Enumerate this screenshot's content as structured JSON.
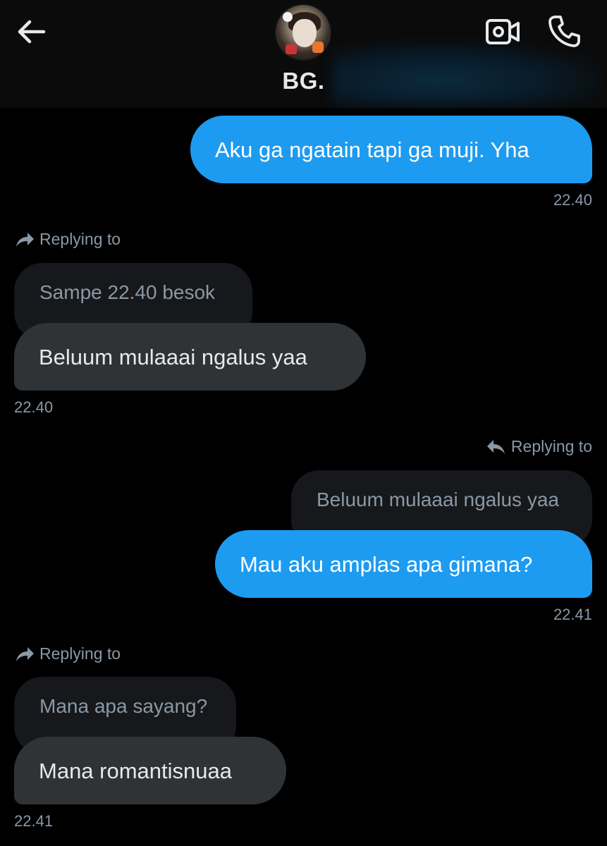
{
  "header": {
    "title": "BG.",
    "back_icon": "arrow-left-icon",
    "video_icon": "video-call-icon",
    "phone_icon": "phone-icon"
  },
  "colors": {
    "sent_bubble": "#1d9bf0",
    "received_bubble": "#2f3336",
    "quoted_bubble": "#16181c",
    "muted_text": "#8b98a5",
    "background": "#000000"
  },
  "messages": [
    {
      "direction": "sent",
      "text": "Aku ga ngatain tapi ga muji. Yha",
      "time": "22.40"
    },
    {
      "direction": "received",
      "reply_label": "Replying to",
      "quoted": "Sampe 22.40 besok",
      "text": "Beluum mulaaai ngalus yaa",
      "time": "22.40"
    },
    {
      "direction": "sent",
      "reply_label": "Replying to",
      "quoted": "Beluum mulaaai ngalus yaa",
      "text": "Mau aku amplas apa gimana?",
      "time": "22.41"
    },
    {
      "direction": "received",
      "reply_label": "Replying to",
      "quoted": "Mana apa sayang?",
      "text": "Mana romantisnuaa",
      "time": "22.41"
    }
  ]
}
